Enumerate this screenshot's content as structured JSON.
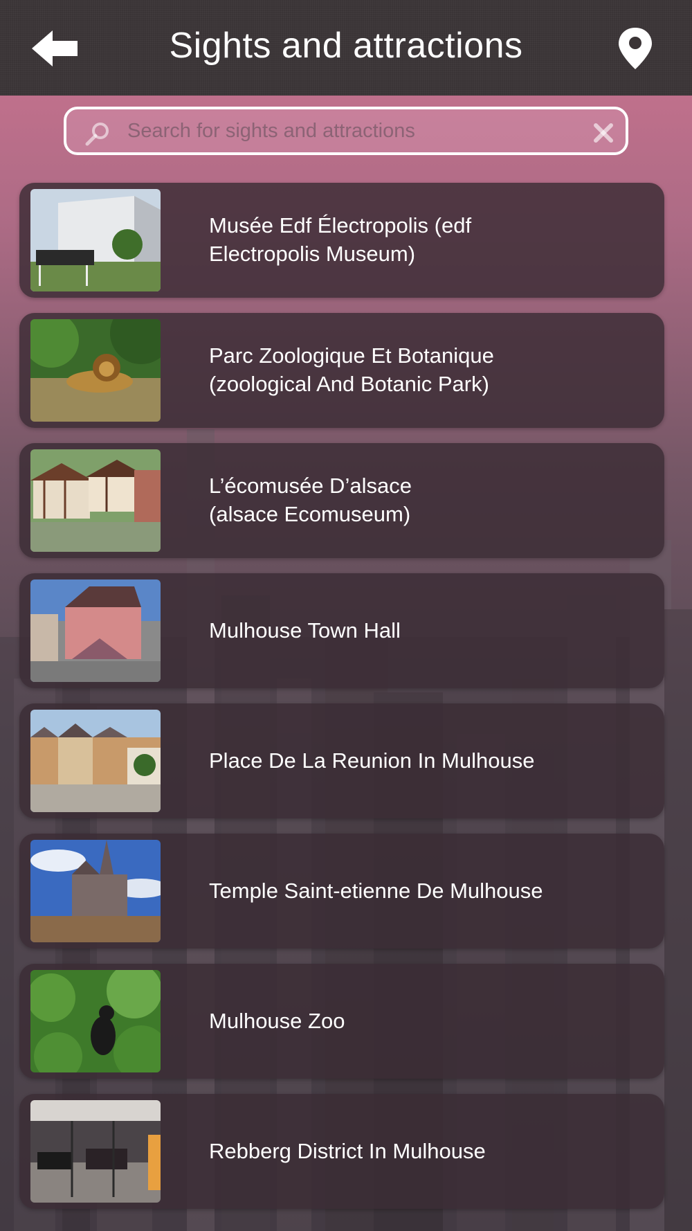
{
  "header": {
    "title": "Sights and attractions",
    "back_icon": "back-arrow-icon",
    "location_icon": "map-pin-icon"
  },
  "search": {
    "placeholder": "Search for sights and attractions",
    "value": ""
  },
  "colors": {
    "header_bg": "#3a3436",
    "accent_pink": "#d67896",
    "row_bg": "#3a2c34",
    "text": "#ffffff"
  },
  "items": [
    {
      "label": "Musée Edf Électropolis (edf\nElectropolis Museum)",
      "thumb": "museum-building-photo"
    },
    {
      "label": "Parc Zoologique Et Botanique\n(zoological And Botanic Park)",
      "thumb": "lion-photo"
    },
    {
      "label": "L’écomusée D’alsace\n(alsace Ecomuseum)",
      "thumb": "half-timbered-village-photo"
    },
    {
      "label": "Mulhouse Town Hall",
      "thumb": "town-hall-photo"
    },
    {
      "label": "Place De La Reunion In Mulhouse",
      "thumb": "town-square-photo"
    },
    {
      "label": "Temple Saint-etienne De Mulhouse",
      "thumb": "gothic-church-photo"
    },
    {
      "label": "Mulhouse Zoo",
      "thumb": "monkey-in-foliage-photo"
    },
    {
      "label": "Rebberg District In Mulhouse",
      "thumb": "car-museum-hall-photo"
    }
  ]
}
